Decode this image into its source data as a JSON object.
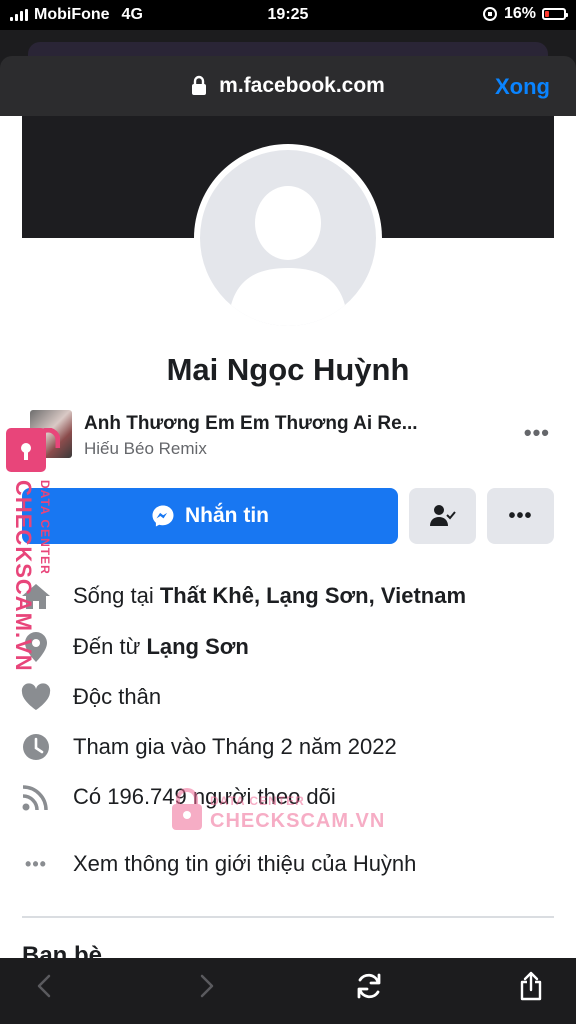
{
  "status_bar": {
    "carrier": "MobiFone",
    "network": "4G",
    "time": "19:25",
    "battery": "16%"
  },
  "browser": {
    "url": "m.facebook.com",
    "done_label": "Xong"
  },
  "profile": {
    "name": "Mai Ngọc Huỳnh",
    "song": {
      "title": "Anh Thương Em Em Thương Ai Re...",
      "artist": "Hiếu Béo Remix"
    },
    "message_button": "Nhắn tin",
    "info": {
      "lives_prefix": "Sống tại ",
      "lives_place": "Thất Khê, Lạng Sơn, Vietnam",
      "from_prefix": "Đến từ ",
      "from_place": "Lạng Sơn",
      "relationship": "Độc thân",
      "joined": "Tham gia vào Tháng 2 năm 2022",
      "followers": "Có 196.749 người theo dõi",
      "see_about": "Xem thông tin giới thiệu của Huỳnh"
    },
    "friends_heading": "Bạn bè"
  },
  "watermark": {
    "line1": "DATA CENTER",
    "line2": "CHECKSCAM.VN"
  },
  "icons": [
    "lock-icon",
    "messenger-icon",
    "friend-check-icon",
    "more-icon",
    "home-icon",
    "location-pin-icon",
    "heart-icon",
    "clock-icon",
    "rss-icon",
    "back-icon",
    "forward-icon",
    "reload-icon",
    "share-icon"
  ],
  "colors": {
    "facebook_blue": "#1877f2",
    "ios_link_blue": "#0a84ff",
    "watermark_pink": "#e8457a"
  }
}
